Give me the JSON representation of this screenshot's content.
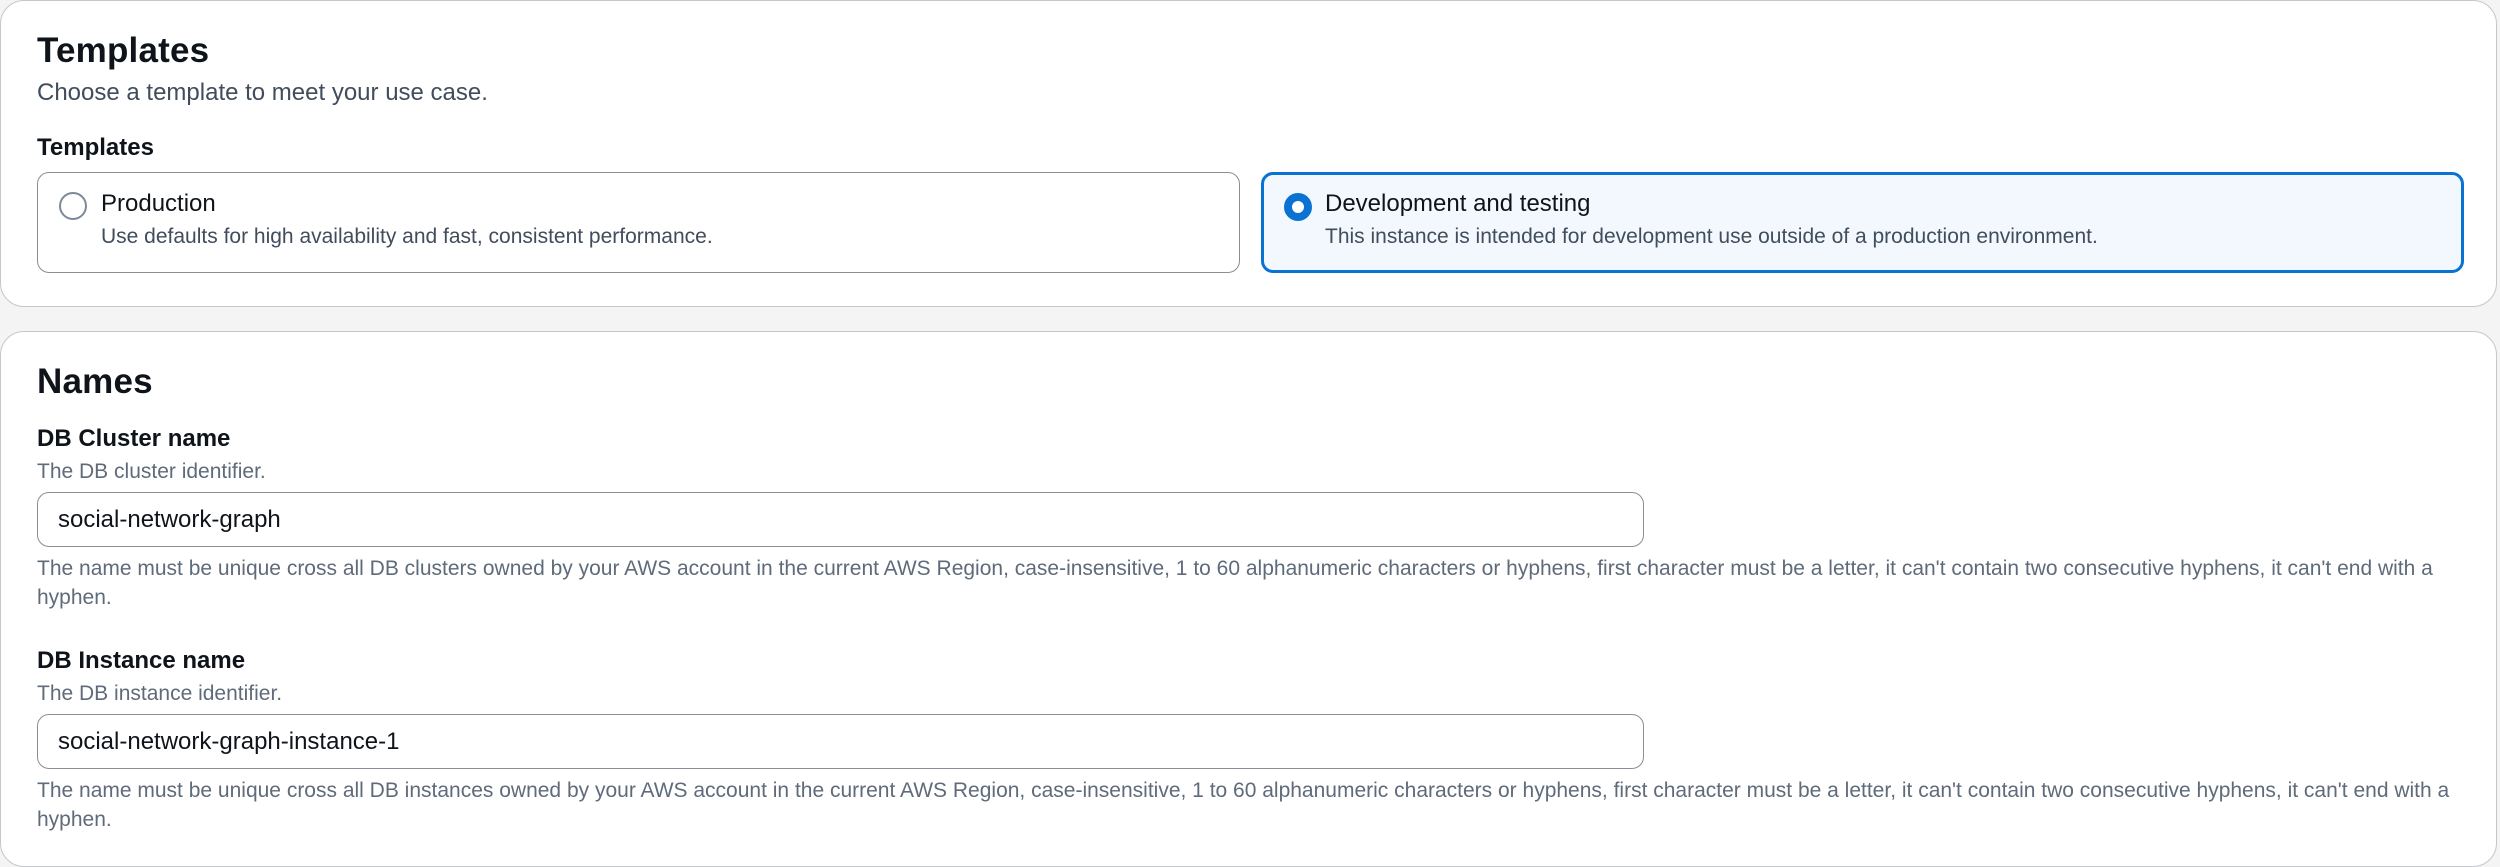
{
  "templates_section": {
    "title": "Templates",
    "description": "Choose a template to meet your use case.",
    "group_label": "Templates",
    "options": [
      {
        "title": "Production",
        "description": "Use defaults for high availability and fast, consistent performance.",
        "selected": false
      },
      {
        "title": "Development and testing",
        "description": "This instance is intended for development use outside of a production environment.",
        "selected": true
      }
    ]
  },
  "names_section": {
    "title": "Names",
    "cluster": {
      "label": "DB Cluster name",
      "description": "The DB cluster identifier.",
      "value": "social-network-graph",
      "constraint": "The name must be unique cross all DB clusters owned by your AWS account in the current AWS Region, case-insensitive, 1 to 60 alphanumeric characters or hyphens, first character must be a letter, it can't contain two consecutive hyphens, it can't end with a hyphen."
    },
    "instance": {
      "label": "DB Instance name",
      "description": "The DB instance identifier.",
      "value": "social-network-graph-instance-1",
      "constraint": "The name must be unique cross all DB instances owned by your AWS account in the current AWS Region, case-insensitive, 1 to 60 alphanumeric characters or hyphens, first character must be a letter, it can't contain two consecutive hyphens, it can't end with a hyphen."
    }
  },
  "colors": {
    "accent": "#0972d3",
    "selected_tile_bg": "#f2f8fd",
    "border": "#8c8c94"
  },
  "icons": {
    "radio_unselected": "radio-unselected-icon",
    "radio_selected": "radio-selected-icon"
  }
}
